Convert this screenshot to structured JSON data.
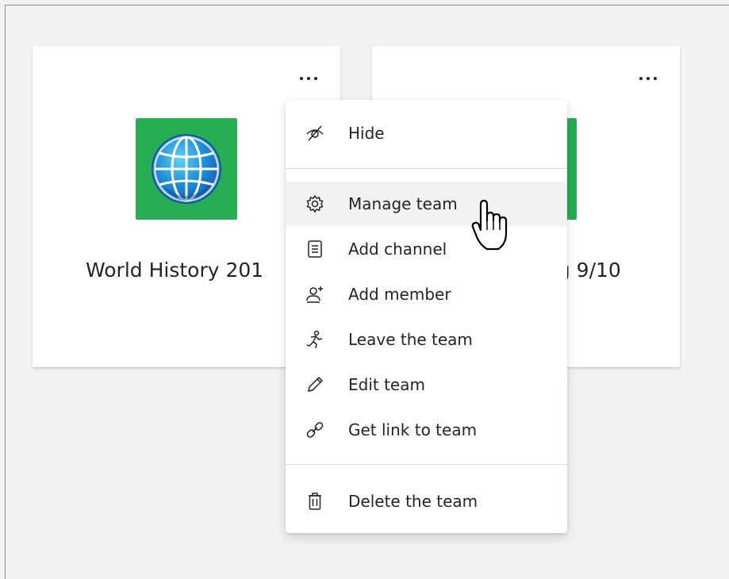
{
  "teams": [
    {
      "name": "World History 201",
      "icon": "globe-icon",
      "color": "#27ae52"
    },
    {
      "name": "ng 9/10",
      "icon": "team-tile",
      "color": "#27ae52"
    }
  ],
  "more_options_label": "···",
  "context_menu": {
    "items": [
      {
        "label": "Hide",
        "icon": "hide-icon"
      },
      {
        "label": "Manage team",
        "icon": "gear-icon",
        "hovered": true
      },
      {
        "label": "Add channel",
        "icon": "channel-icon"
      },
      {
        "label": "Add member",
        "icon": "add-member-icon"
      },
      {
        "label": "Leave the team",
        "icon": "leave-icon"
      },
      {
        "label": "Edit team",
        "icon": "pencil-icon"
      },
      {
        "label": "Get link to team",
        "icon": "link-icon"
      },
      {
        "label": "Delete the team",
        "icon": "trash-icon"
      }
    ]
  },
  "colors": {
    "background": "#f3f2f1",
    "card": "#ffffff",
    "hover": "#f3f2f1",
    "accent_green": "#27ae52"
  }
}
